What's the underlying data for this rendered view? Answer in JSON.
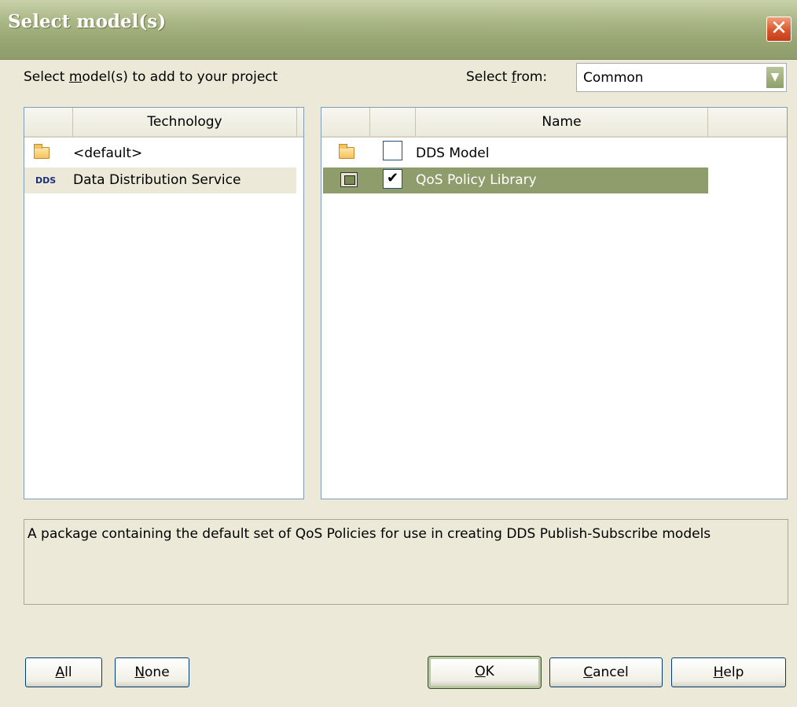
{
  "window": {
    "title": "Select model(s)",
    "close_label": "✕"
  },
  "instruction": {
    "prefix": "Select ",
    "mnemonic": "m",
    "suffix": "odel(s) to add to your project"
  },
  "select_from": {
    "label_prefix": "Select ",
    "label_mnemonic": "f",
    "label_suffix": "rom:",
    "value": "Common"
  },
  "technology_panel": {
    "header": "Technology",
    "items": [
      {
        "label": "<default>",
        "icon": "folder-icon"
      },
      {
        "label": "Data Distribution Service",
        "icon": "dds-icon",
        "icon_text": "DDS",
        "selected": true
      }
    ]
  },
  "name_panel": {
    "header": "Name",
    "items": [
      {
        "label": "DDS Model",
        "icon": "folder-icon",
        "checked": false
      },
      {
        "label": "QoS Policy Library",
        "icon": "library-icon",
        "checked": true,
        "selected": true
      }
    ]
  },
  "description": "A package containing the default set of QoS Policies for use in creating DDS Publish-Subscribe models",
  "buttons": {
    "all": {
      "mnemonic": "A",
      "rest": "ll"
    },
    "none": {
      "mnemonic": "N",
      "rest": "one"
    },
    "ok": {
      "mnemonic": "O",
      "rest": "K"
    },
    "cancel": {
      "mnemonic": "C",
      "rest": "ancel"
    },
    "help": {
      "mnemonic": "H",
      "rest": "elp"
    }
  },
  "colors": {
    "titlebar": "#98a673",
    "selection_highlight": "#8f9c6b",
    "technology_selected_bg": "#ece9d8",
    "dialog_bg": "#ece9d8"
  }
}
